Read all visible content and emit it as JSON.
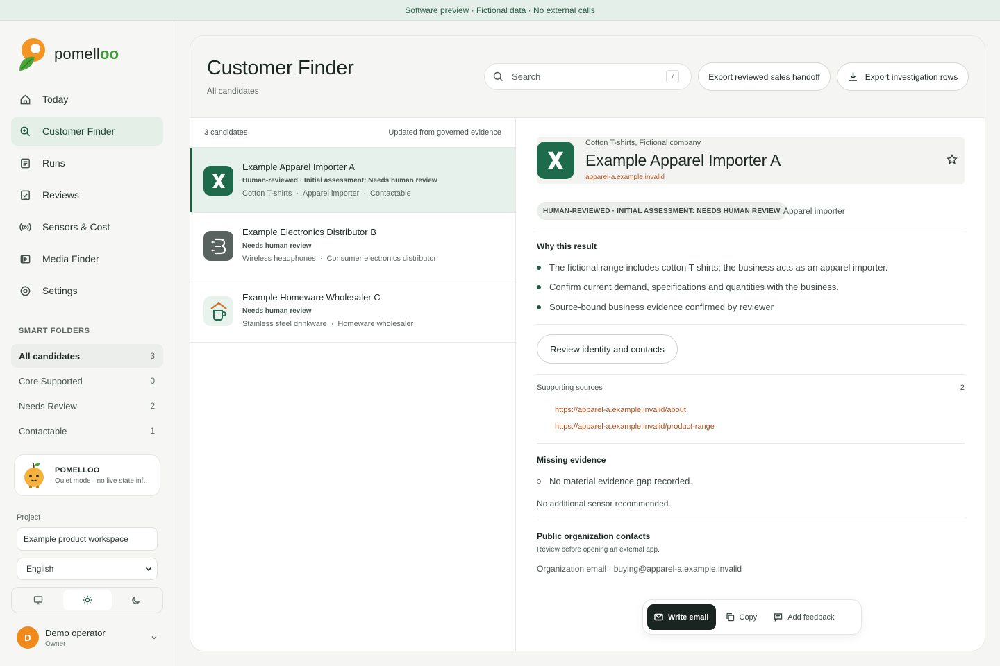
{
  "banner": "Software preview · Fictional data · No external calls",
  "brand": {
    "name_main": "pomell",
    "name_tail": "oo"
  },
  "nav": [
    {
      "label": "Today",
      "icon": "home-icon"
    },
    {
      "label": "Customer Finder",
      "icon": "search-zoom-icon",
      "active": true
    },
    {
      "label": "Runs",
      "icon": "document-icon"
    },
    {
      "label": "Reviews",
      "icon": "clipboard-check-icon"
    },
    {
      "label": "Sensors & Cost",
      "icon": "broadcast-icon"
    },
    {
      "label": "Media Finder",
      "icon": "media-icon"
    },
    {
      "label": "Settings",
      "icon": "gear-icon"
    }
  ],
  "smart_folders": {
    "title": "SMART FOLDERS",
    "items": [
      {
        "label": "All candidates",
        "count": "3",
        "active": true
      },
      {
        "label": "Core Supported",
        "count": "0"
      },
      {
        "label": "Needs Review",
        "count": "2"
      },
      {
        "label": "Contactable",
        "count": "1"
      }
    ]
  },
  "mascot": {
    "name": "POMELLOO",
    "status": "Quiet mode · no live state inference"
  },
  "project": {
    "label": "Project",
    "value": "Example product workspace",
    "language": "English"
  },
  "theme": {
    "options": [
      "monitor-icon",
      "sun-icon",
      "moon-icon"
    ],
    "selected": "sun-icon"
  },
  "user": {
    "initial": "D",
    "name": "Demo operator",
    "role": "Owner"
  },
  "header": {
    "title": "Customer Finder",
    "subtitle": "All candidates",
    "search_placeholder": "Search",
    "search_shortcut": "/",
    "export_handoff": "Export reviewed sales handoff",
    "export_rows": "Export investigation rows"
  },
  "list": {
    "count_label": "3 candidates",
    "updated_label": "Updated from governed evidence",
    "candidates": [
      {
        "name": "Example Apparel Importer A",
        "status": "Human-reviewed · Initial assessment: Needs human review",
        "tags": [
          "Cotton T-shirts",
          "Apparel importer",
          "Contactable"
        ],
        "logo": "x-logo-icon"
      },
      {
        "name": "Example Electronics Distributor B",
        "status": "Needs human review",
        "tags": [
          "Wireless headphones",
          "Consumer electronics distributor"
        ],
        "logo": "b-logo-icon"
      },
      {
        "name": "Example Homeware Wholesaler C",
        "status": "Needs human review",
        "tags": [
          "Stainless steel drinkware",
          "Homeware wholesaler"
        ],
        "logo": "cup-logo-icon"
      }
    ]
  },
  "detail": {
    "kicker": "Cotton T-shirts, Fictional company",
    "name": "Example Apparel Importer A",
    "domain": "apparel-a.example.invalid",
    "status_chip": "HUMAN-REVIEWED · INITIAL ASSESSMENT: NEEDS HUMAN REVIEW",
    "role": "Apparel importer",
    "why_title": "Why this result",
    "why": [
      "The fictional range includes cotton T-shirts; the business acts as an apparel importer.",
      "Confirm current demand, specifications and quantities with the business.",
      "Source-bound business evidence confirmed by reviewer"
    ],
    "review_button": "Review identity and contacts",
    "sources_label": "Supporting sources",
    "sources_count": "2",
    "sources": [
      "https://apparel-a.example.invalid/about",
      "https://apparel-a.example.invalid/product-range"
    ],
    "missing_title": "Missing evidence",
    "missing_item": "No material evidence gap recorded.",
    "sensor_note": "No additional sensor recommended.",
    "contacts_title": "Public organization contacts",
    "contacts_note": "Review before opening an external app.",
    "contact_email": "Organization email · buying@apparel-a.example.invalid"
  },
  "actions": {
    "write_email": "Write email",
    "copy": "Copy",
    "feedback": "Add feedback"
  },
  "colors": {
    "accent": "#1f5c40",
    "active_bg": "#e5f1ea",
    "link": "#b5511e",
    "brand_orange": "#f18a1c"
  }
}
